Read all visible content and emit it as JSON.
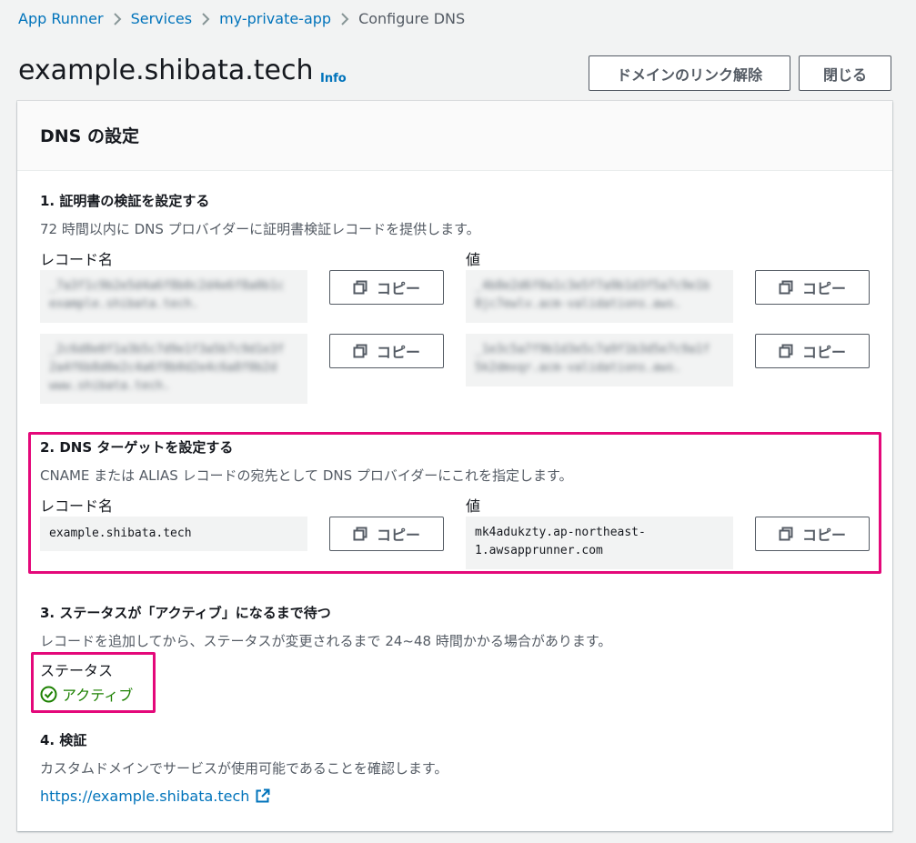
{
  "breadcrumb": {
    "items": [
      {
        "label": "App Runner"
      },
      {
        "label": "Services"
      },
      {
        "label": "my-private-app"
      }
    ],
    "current": "Configure DNS"
  },
  "header": {
    "title": "example.shibata.tech",
    "info": "Info",
    "unlink_button": "ドメインのリンク解除",
    "close_button": "閉じる"
  },
  "panel": {
    "title": "DNS の設定"
  },
  "step1": {
    "title": "1. 証明書の検証を設定する",
    "description": "72 時間以内に DNS プロバイダーに証明書検証レコードを提供します。",
    "name_label": "レコード名",
    "value_label": "値",
    "copy": "コピー",
    "records": [
      {
        "name": "_7a3f1c9b2e5d4a6f8b0c2d4e6f8a0b1c",
        "name2": "example.shibata.tech.",
        "value": "_4b8e2d6f0a1c3e5f7a9b1d3f5a7c9e1b",
        "value2": "8jc7ewlv.acm-validations.aws."
      },
      {
        "name": "_2c6d8e0f1a3b5c7d9e1f3a5b7c9d1e3f",
        "name2": "2a4f6b8d0e2c4a6f8b0d2e4c6a8f0b2d",
        "name3": "www.shibata.tech.",
        "value": "_1e3c5a7f9b1d3e5c7a9f1b3d5e7c9a1f",
        "value2": "5k2dmxqr.acm-validations.aws."
      }
    ]
  },
  "step2": {
    "title": "2. DNS ターゲットを設定する",
    "description": "CNAME または ALIAS レコードの宛先として DNS プロバイダーにこれを指定します。",
    "name_label": "レコード名",
    "value_label": "値",
    "record_name": "example.shibata.tech",
    "record_value_line1": "mk4adukzty.ap-northeast-",
    "record_value_line2": "1.awsapprunner.com",
    "copy": "コピー"
  },
  "step3": {
    "title": "3. ステータスが「アクティブ」になるまで待つ",
    "description": "レコードを追加してから、ステータスが変更されるまで 24~48 時間かかる場合があります。",
    "status_label": "ステータス",
    "status_value": "アクティブ",
    "status_color": "#1d8102"
  },
  "step4": {
    "title": "4. 検証",
    "description": "カスタムドメインでサービスが使用可能であることを確認します。",
    "link": "https://example.shibata.tech"
  },
  "colors": {
    "link": "#0073bb",
    "highlight": "#e4087a",
    "border": "#545b64"
  }
}
